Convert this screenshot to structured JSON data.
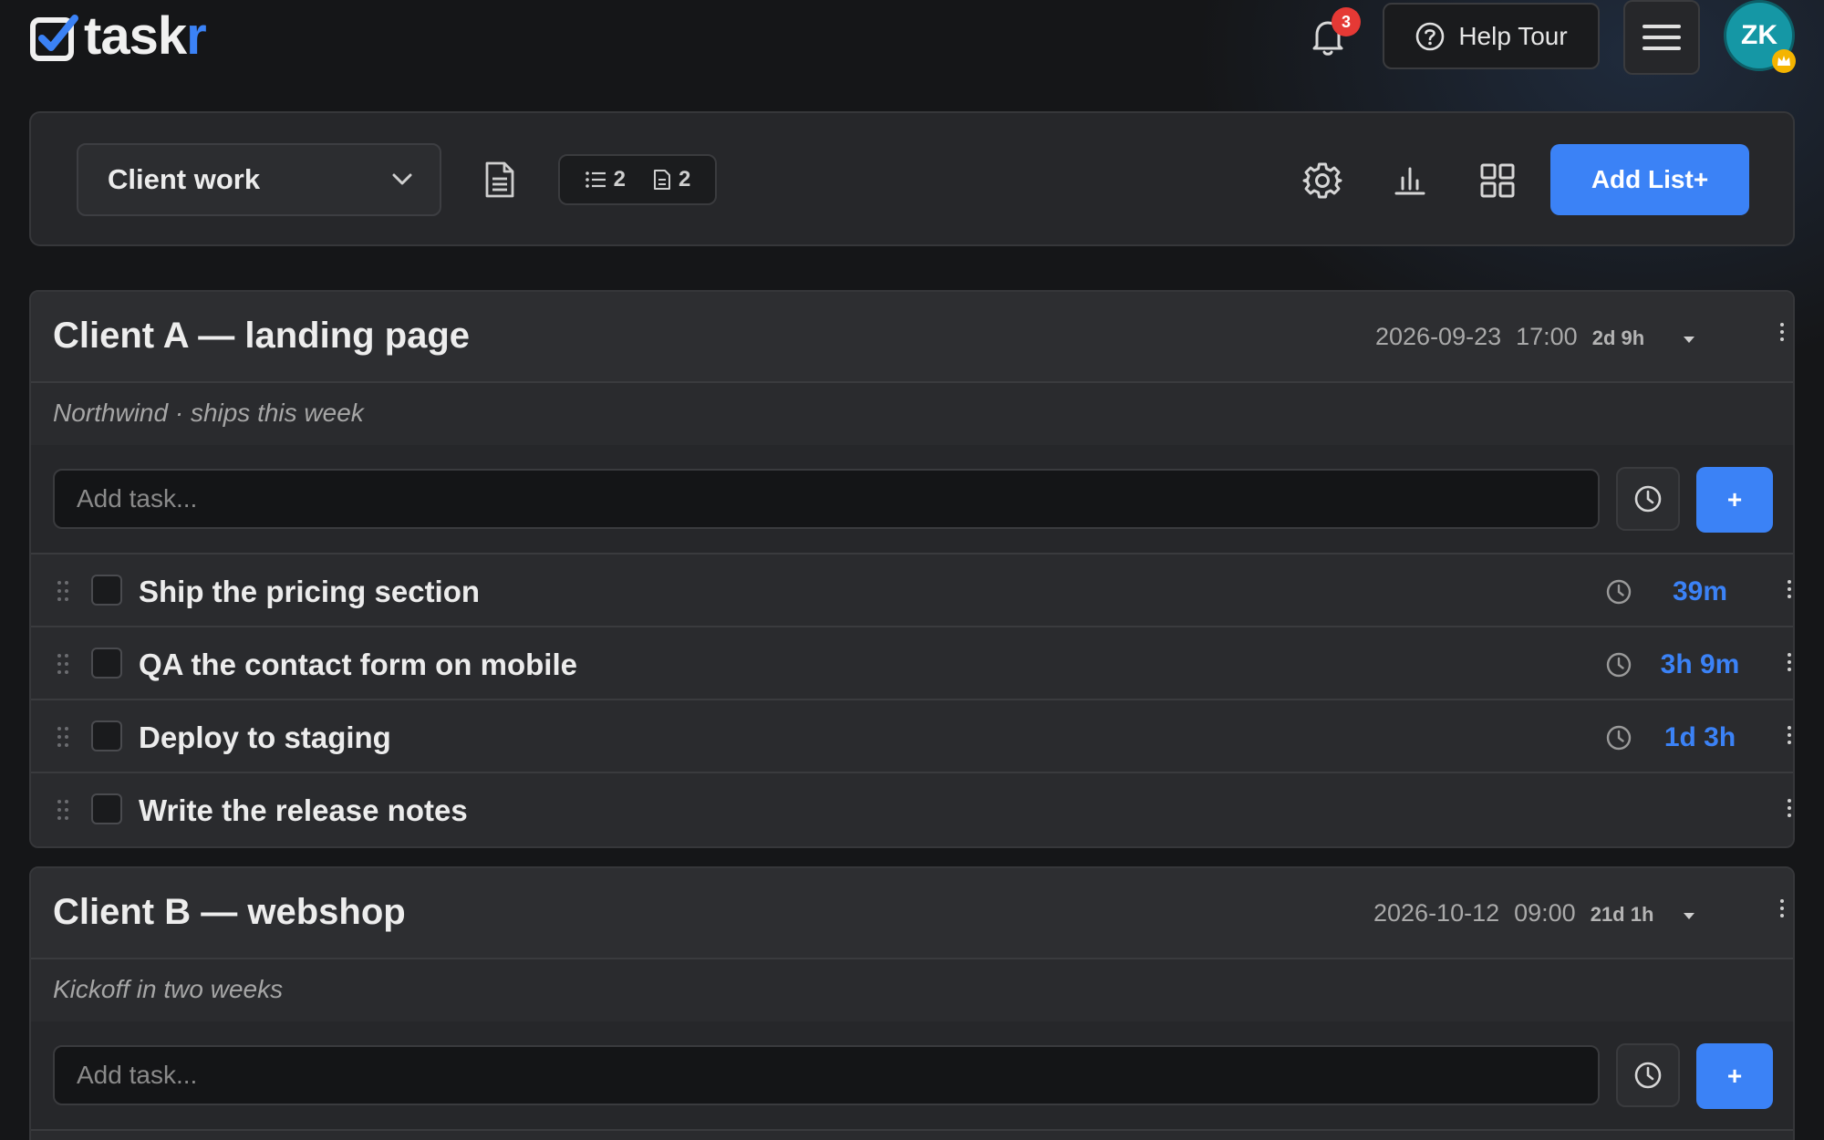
{
  "app": {
    "logo_part1": "task",
    "logo_part2": "r",
    "notifications_count": "3",
    "help_tour_label": "Help Tour",
    "avatar_initials": "ZK"
  },
  "toolbar": {
    "selected_list": "Client work",
    "lists_count": "2",
    "notes_count": "2",
    "add_list_label": "Add List+"
  },
  "lists": [
    {
      "title": "Client A — landing page",
      "due_date": "2026-09-23",
      "due_time": "17:00",
      "due_relative": "2d 9h",
      "description": "Northwind · ships this week",
      "add_placeholder": "Add task...",
      "add_button_label": "+",
      "tasks": [
        {
          "label": "Ship the pricing section",
          "duration": "39m"
        },
        {
          "label": "QA the contact form on mobile",
          "duration": "3h 9m"
        },
        {
          "label": "Deploy to staging",
          "duration": "1d 3h"
        },
        {
          "label": "Write the release notes",
          "duration": ""
        }
      ]
    },
    {
      "title": "Client B — webshop",
      "due_date": "2026-10-12",
      "due_time": "09:00",
      "due_relative": "21d 1h",
      "description": "Kickoff in two weeks",
      "add_placeholder": "Add task...",
      "add_button_label": "+",
      "tasks": []
    }
  ],
  "colors": {
    "accent": "#3b82f6",
    "background": "#151618",
    "panel": "#26272a",
    "badge": "#e53935",
    "avatar": "#1597a5"
  }
}
